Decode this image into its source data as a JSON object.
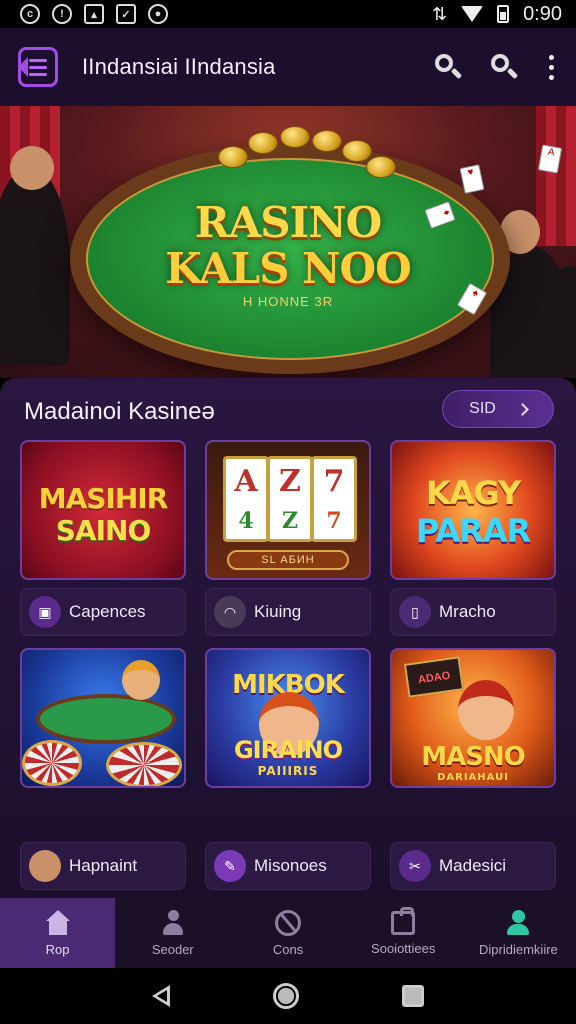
{
  "status_bar": {
    "time": "0:90",
    "left_icons": [
      "whatsapp-icon",
      "notification-icon",
      "image-icon",
      "mail-icon",
      "app-icon"
    ]
  },
  "app_bar": {
    "title": "IIndansiai IIndansia"
  },
  "hero": {
    "logo_line1": "RASINO",
    "logo_line2": "KALS NOO",
    "sub_text": "H HONNE 3R"
  },
  "section": {
    "title": "Madainoi Kasineə",
    "see_all_label": "SID"
  },
  "games": [
    {
      "tile_line1": "MASIHIR",
      "tile_line2": "SAINO",
      "label": "Capences",
      "icon": "gamepad-icon"
    },
    {
      "tile_line1": "SL АБИН",
      "tile_line2": "",
      "label": "Kiuing",
      "icon": "headphones-icon",
      "reels": [
        "A",
        "Z",
        "7"
      ],
      "reels_row2": [
        "4",
        "Z",
        "7"
      ]
    },
    {
      "tile_line1": "KAGY",
      "tile_line2": "PARAR",
      "label": "Mracho",
      "icon": "phone-icon"
    },
    {
      "tile_line1": "",
      "tile_line2": "",
      "label": "Hapnaint",
      "icon": "avatar-icon"
    },
    {
      "tile_line1": "MIKBOK",
      "tile_line2": "GIRAINO",
      "tile_line3": "PAIIIRIS",
      "label": "Misonoes",
      "icon": "pen-icon"
    },
    {
      "tile_line1": "ADAO",
      "tile_line2": "MASNO",
      "tile_line3": "DARIAHAUI",
      "label": "Madesici",
      "icon": "tool-icon"
    }
  ],
  "bottom_nav": [
    {
      "label": "Rop",
      "icon": "home-icon",
      "active": true
    },
    {
      "label": "Seoder",
      "icon": "user-icon",
      "active": false
    },
    {
      "label": "Cons",
      "icon": "compass-icon",
      "active": false
    },
    {
      "label": "Sooiottiees",
      "icon": "bag-icon",
      "active": false
    },
    {
      "label": "Dipridiemkiire",
      "icon": "profile-icon",
      "active": false
    }
  ],
  "colors": {
    "accent": "#a24ce8",
    "background": "#1b0f2b",
    "active_nav": "#4a2a72",
    "profile_accent": "#2ec7a6"
  }
}
